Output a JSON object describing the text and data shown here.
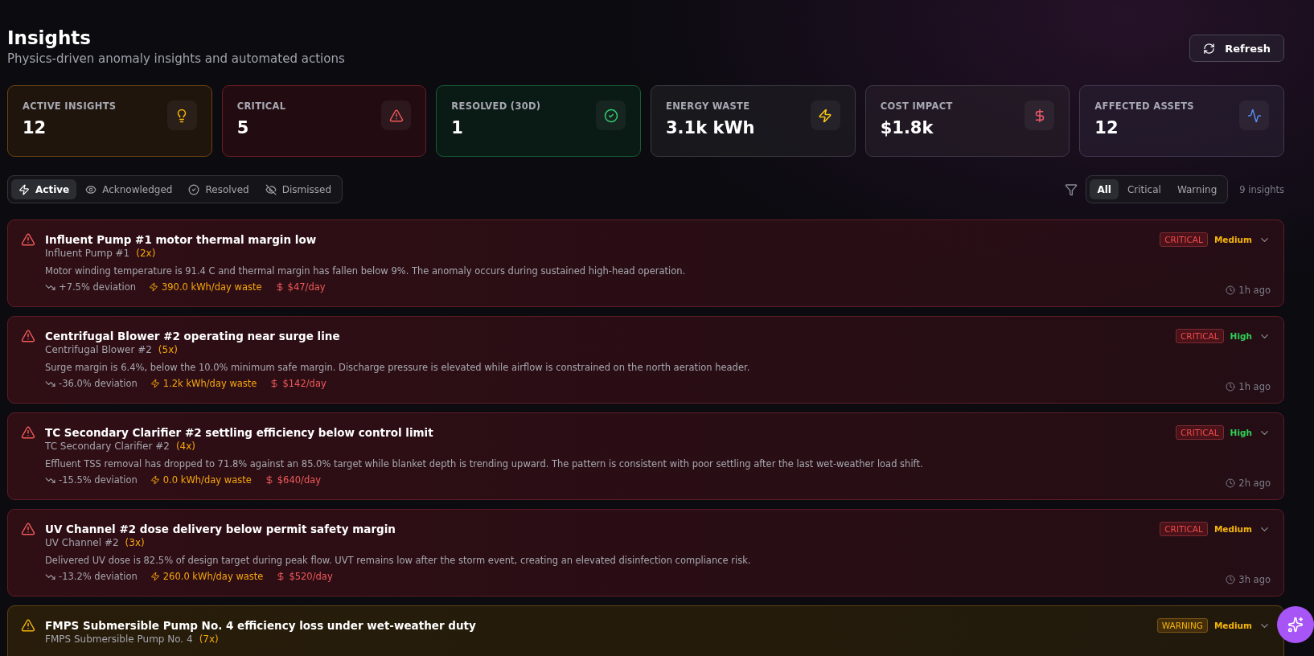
{
  "header": {
    "title": "Insights",
    "subtitle": "Physics-driven anomaly insights and automated actions",
    "refresh_button": "Refresh"
  },
  "stats": [
    {
      "kind": "active",
      "label": "ACTIVE INSIGHTS",
      "value": "12"
    },
    {
      "kind": "critical",
      "label": "CRITICAL",
      "value": "5"
    },
    {
      "kind": "resolved",
      "label": "RESOLVED (30D)",
      "value": "1"
    },
    {
      "kind": "energy",
      "label": "ENERGY WASTE",
      "value": "3.1k kWh"
    },
    {
      "kind": "cost",
      "label": "COST IMPACT",
      "value": "$1.8k"
    },
    {
      "kind": "assets",
      "label": "AFFECTED ASSETS",
      "value": "12"
    }
  ],
  "status_tabs": [
    {
      "kind": "active",
      "label": "Active",
      "selected": true
    },
    {
      "kind": "acknowledged",
      "label": "Acknowledged",
      "selected": false
    },
    {
      "kind": "resolved",
      "label": "Resolved",
      "selected": false
    },
    {
      "kind": "dismissed",
      "label": "Dismissed",
      "selected": false
    }
  ],
  "severity_filter": [
    {
      "label": "All",
      "selected": true
    },
    {
      "label": "Critical",
      "selected": false
    },
    {
      "label": "Warning",
      "selected": false
    }
  ],
  "insight_count": "9 insights",
  "insights": [
    {
      "kind": "critical",
      "severity": "CRITICAL",
      "title": "Influent Pump #1 motor thermal margin low",
      "asset": "Influent Pump #1",
      "count": "(2x)",
      "description": "Motor winding temperature is 91.4 C and thermal margin has fallen below 9%. The anomaly occurs during sustained high-head operation.",
      "deviation": "+7.5% deviation",
      "energy": "390.0 kWh/day waste",
      "cost": "$47/day",
      "priority": {
        "label": "Medium",
        "color": "#f5b50b"
      },
      "time": "1h ago"
    },
    {
      "kind": "critical",
      "severity": "CRITICAL",
      "title": "Centrifugal Blower #2 operating near surge line",
      "asset": "Centrifugal Blower #2",
      "count": "(5x)",
      "description": "Surge margin is 6.4%, below the 10.0% minimum safe margin. Discharge pressure is elevated while airflow is constrained on the north aeration header.",
      "deviation": "-36.0% deviation",
      "energy": "1.2k kWh/day waste",
      "cost": "$142/day",
      "priority": {
        "label": "High",
        "color": "#2fcf55"
      },
      "time": "1h ago"
    },
    {
      "kind": "critical",
      "severity": "CRITICAL",
      "title": "TC Secondary Clarifier #2 settling efficiency below control limit",
      "asset": "TC Secondary Clarifier #2",
      "count": "(4x)",
      "description": "Effluent TSS removal has dropped to 71.8% against an 85.0% target while blanket depth is trending upward. The pattern is consistent with poor settling after the last wet-weather load shift.",
      "deviation": "-15.5% deviation",
      "energy": "0.0 kWh/day waste",
      "cost": "$640/day",
      "priority": {
        "label": "High",
        "color": "#2fcf55"
      },
      "time": "2h ago"
    },
    {
      "kind": "critical",
      "severity": "CRITICAL",
      "title": "UV Channel #2 dose delivery below permit safety margin",
      "asset": "UV Channel #2",
      "count": "(3x)",
      "description": "Delivered UV dose is 82.5% of design target during peak flow. UVT remains low after the storm event, creating an elevated disinfection compliance risk.",
      "deviation": "-13.2% deviation",
      "energy": "260.0 kWh/day waste",
      "cost": "$520/day",
      "priority": {
        "label": "Medium",
        "color": "#f5b50b"
      },
      "time": "3h ago"
    },
    {
      "kind": "warning",
      "severity": "WARNING",
      "title": "FMPS Submersible Pump No. 4 efficiency loss under wet-weather duty",
      "asset": "FMPS Submersible Pump No. 4",
      "count": "(7x)",
      "priority": {
        "label": "Medium",
        "color": "#f5b50b"
      }
    }
  ]
}
